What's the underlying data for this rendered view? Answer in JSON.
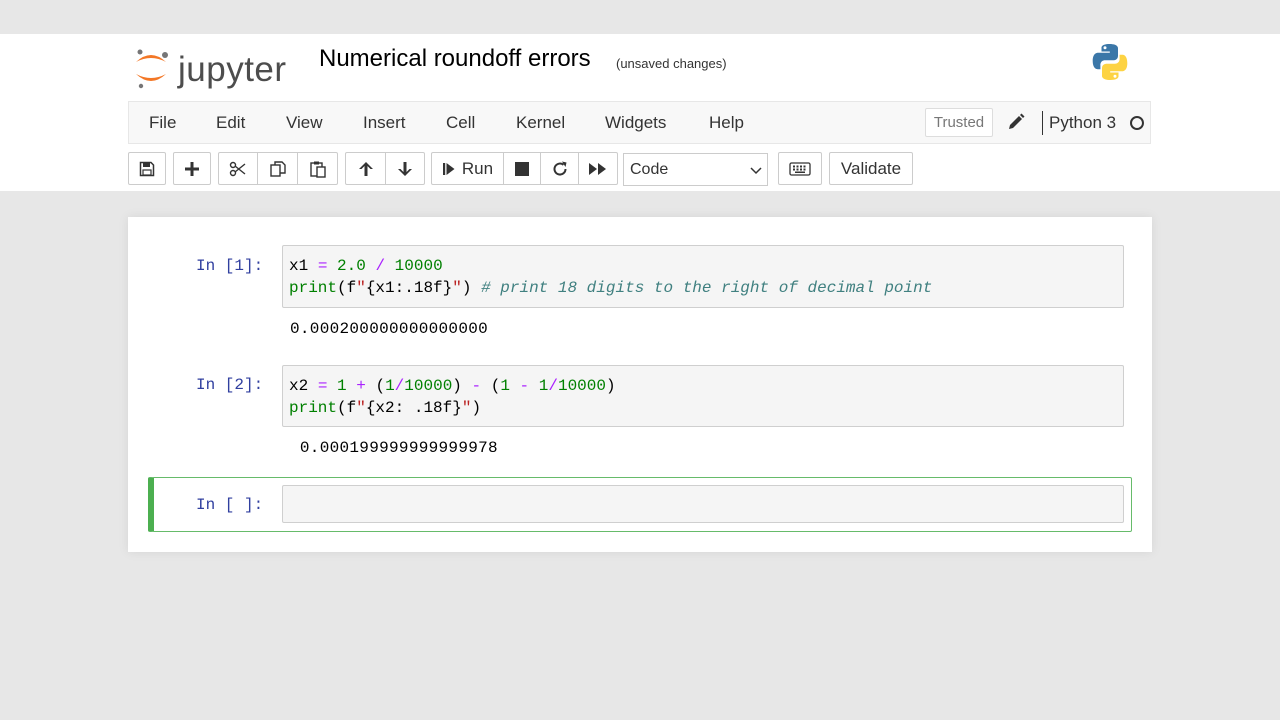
{
  "header": {
    "logo_text": "jupyter",
    "notebook_title": "Numerical roundoff errors",
    "save_status": "(unsaved changes)"
  },
  "menu": {
    "items": [
      "File",
      "Edit",
      "View",
      "Insert",
      "Cell",
      "Kernel",
      "Widgets",
      "Help"
    ],
    "trusted": "Trusted",
    "kernel_name": "Python 3"
  },
  "toolbar": {
    "run_label": "Run",
    "cell_type": "Code",
    "validate_label": "Validate"
  },
  "cells": [
    {
      "prompt": "In [1]:",
      "code_line1": "x1 = 2.0 / 10000",
      "code_line2": "print(f\"{x1:.18f}\") # print 18 digits to the right of decimal point",
      "output": "0.000200000000000000"
    },
    {
      "prompt": "In [2]:",
      "code_line1": "x2 = 1 + (1/10000) - (1 - 1/10000)",
      "code_line2": "print(f\"{x2: .18f}\")",
      "output": " 0.000199999999999978"
    },
    {
      "prompt": "In [ ]:"
    }
  ],
  "colors": {
    "prompt": "#303f9f",
    "selected_cell_border": "#66bb6a",
    "code_background": "#f5f5f5"
  }
}
